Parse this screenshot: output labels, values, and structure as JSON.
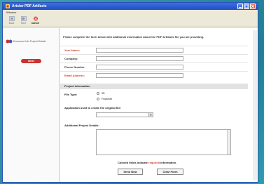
{
  "window": {
    "title": "Artstor PDF Artifacts"
  },
  "menubar": {
    "items": [
      "Window"
    ]
  },
  "toolbar": {
    "items": [
      {
        "label": "Back",
        "icon": "back-icon"
      },
      {
        "label": "Next",
        "icon": "forward-icon"
      },
      {
        "label": "Cancel",
        "icon": "cancel-icon"
      }
    ]
  },
  "sidebar": {
    "steps_text": "Document Info Project Details",
    "next_button": "Next"
  },
  "form": {
    "intro": "Please complete the form below with additional information about the PDF Artifacts file you are providing.",
    "fields": [
      {
        "label": "Your Name:",
        "required": true,
        "value": ""
      },
      {
        "label": "Company:",
        "required": false,
        "value": ""
      },
      {
        "label": "Phone Number:",
        "required": false,
        "value": ""
      },
      {
        "label": "Email Address:",
        "required": true,
        "value": ""
      }
    ],
    "section_title": "Project Information",
    "file_type_label": "File Type:",
    "file_type_options": [
      "3D",
      "Flowchart"
    ],
    "app_used_label": "Application used to create the original file:",
    "app_used_value": "",
    "details_label": "Additional Project Details:",
    "details_value": "",
    "required_note_prefix": "Colored fields indicate",
    "required_note_word": "required",
    "required_note_suffix": "information.",
    "send_button": "Send Now",
    "clear_button": "Clear Form"
  },
  "colors": {
    "required": "#d13b2a",
    "accent": "#c9342f",
    "titlebar": "#2a5bd7"
  }
}
